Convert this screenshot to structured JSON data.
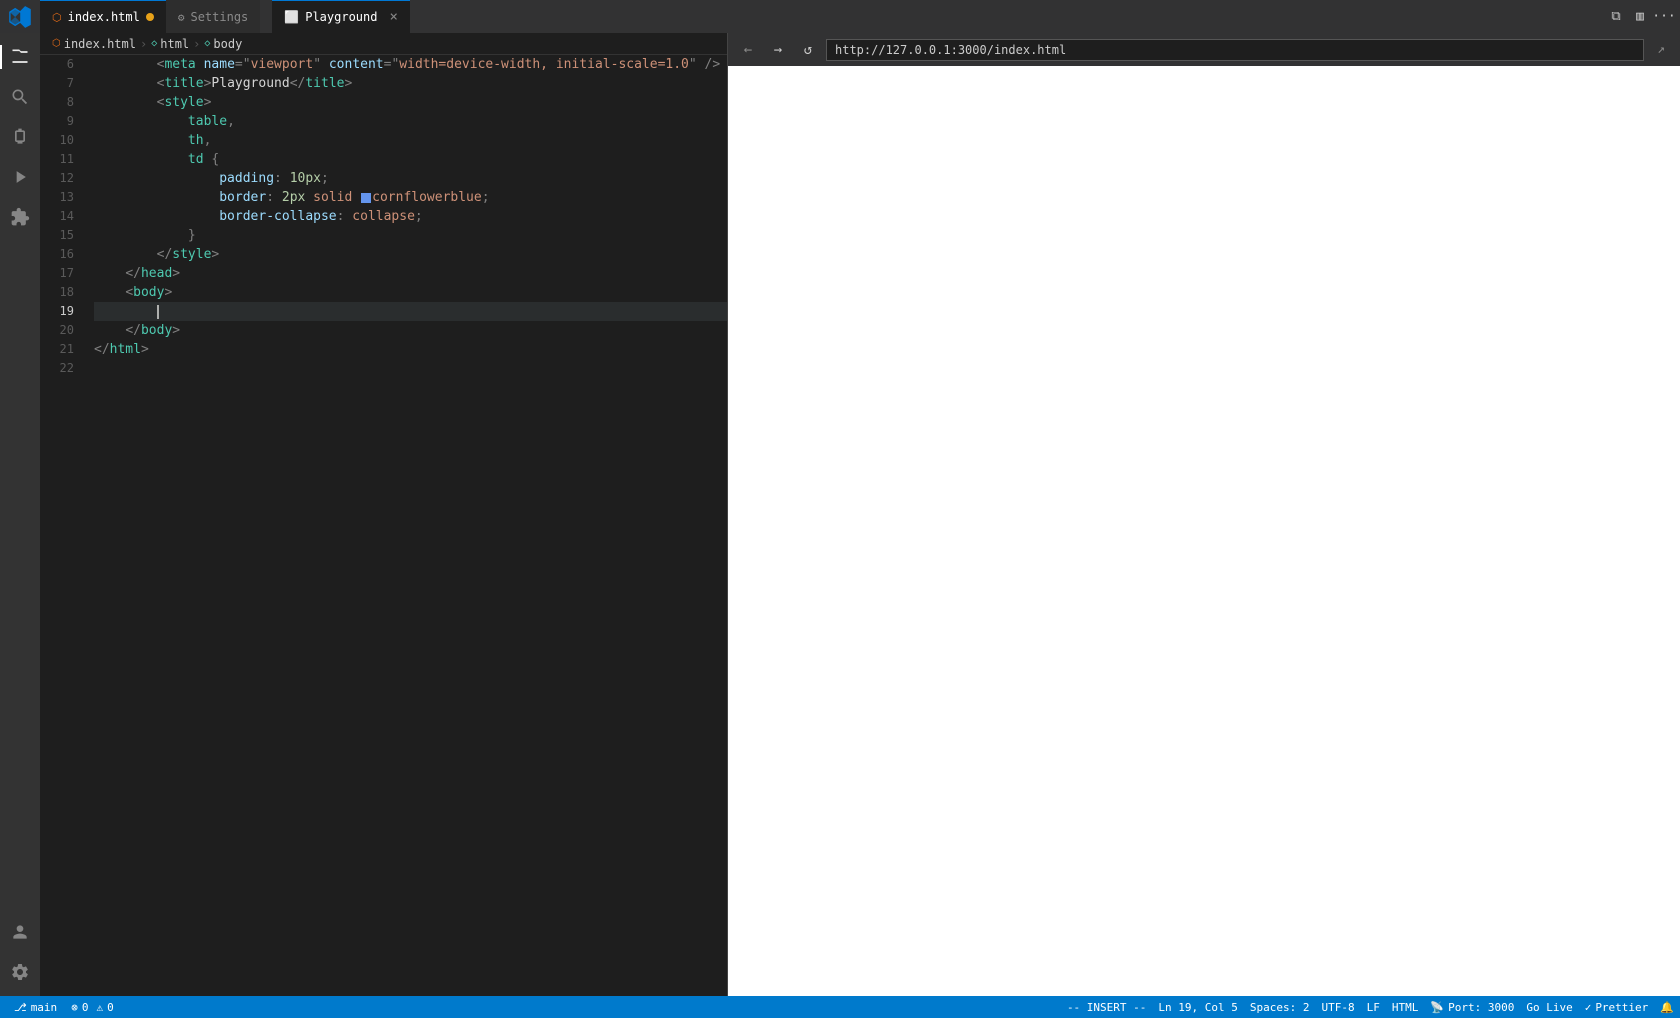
{
  "titleBar": {
    "tabs": [
      {
        "id": "index-html",
        "label": "index.html",
        "icon": "html-icon",
        "active": true,
        "modified": true
      },
      {
        "id": "settings",
        "label": "Settings",
        "icon": "settings-icon",
        "active": false,
        "modified": false
      }
    ],
    "browserTab": {
      "label": "Playground",
      "icon": "globe-icon",
      "close": "×"
    },
    "icons": [
      "split-icon",
      "layout-icon",
      "more-icon"
    ]
  },
  "breadcrumb": {
    "items": [
      "index.html",
      "html",
      "body"
    ]
  },
  "activityBar": {
    "items": [
      {
        "id": "explorer",
        "icon": "files-icon",
        "active": true
      },
      {
        "id": "search",
        "icon": "search-icon",
        "active": false
      },
      {
        "id": "source-control",
        "icon": "git-icon",
        "active": false
      },
      {
        "id": "run",
        "icon": "run-icon",
        "active": false
      },
      {
        "id": "extensions",
        "icon": "extensions-icon",
        "active": false
      }
    ],
    "bottomItems": [
      {
        "id": "account",
        "icon": "account-icon"
      },
      {
        "id": "manage",
        "icon": "manage-icon"
      }
    ]
  },
  "editor": {
    "lines": [
      {
        "num": 6,
        "active": false,
        "content": "meta_viewport"
      },
      {
        "num": 7,
        "active": false,
        "content": "title_playground"
      },
      {
        "num": 8,
        "active": false,
        "content": "style_open"
      },
      {
        "num": 9,
        "active": false,
        "content": "table_comma"
      },
      {
        "num": 10,
        "active": false,
        "content": "th_comma"
      },
      {
        "num": 11,
        "active": false,
        "content": "td_brace"
      },
      {
        "num": 12,
        "active": false,
        "content": "padding"
      },
      {
        "num": 13,
        "active": false,
        "content": "border"
      },
      {
        "num": 14,
        "active": false,
        "content": "border_collapse"
      },
      {
        "num": 15,
        "active": false,
        "content": "close_brace"
      },
      {
        "num": 16,
        "active": false,
        "content": "style_close"
      },
      {
        "num": 17,
        "active": false,
        "content": "head_close"
      },
      {
        "num": 18,
        "active": false,
        "content": "body_open"
      },
      {
        "num": 19,
        "active": true,
        "content": "cursor_line"
      },
      {
        "num": 20,
        "active": false,
        "content": "body_close"
      },
      {
        "num": 21,
        "active": false,
        "content": "html_close"
      },
      {
        "num": 22,
        "active": false,
        "content": "empty"
      }
    ]
  },
  "browser": {
    "url": "http://127.0.0.1:3000/index.html",
    "title": "Playground"
  },
  "statusBar": {
    "left": [
      {
        "id": "git-branch",
        "label": "⎇  main"
      },
      {
        "id": "errors",
        "icon": "error-icon",
        "label": "0"
      },
      {
        "id": "warnings",
        "icon": "warning-icon",
        "label": "0"
      }
    ],
    "right": [
      {
        "id": "mode",
        "label": "-- INSERT --"
      },
      {
        "id": "position",
        "label": "Ln 19, Col 5"
      },
      {
        "id": "spaces",
        "label": "Spaces: 2"
      },
      {
        "id": "encoding",
        "label": "UTF-8"
      },
      {
        "id": "eol",
        "label": "LF"
      },
      {
        "id": "language",
        "label": "HTML"
      },
      {
        "id": "port",
        "icon": "broadcast-icon",
        "label": "Port: 3000"
      },
      {
        "id": "golive",
        "label": "Go Live"
      },
      {
        "id": "prettier",
        "icon": "check-icon",
        "label": "Prettier"
      }
    ]
  },
  "icons": {
    "files": "⬜",
    "search": "🔍",
    "git": "⑂",
    "run": "▷",
    "extensions": "⊞",
    "account": "○",
    "manage": "⚙",
    "back": "←",
    "forward": "→",
    "refresh": "↺",
    "more": "···",
    "split": "⧉",
    "layout": "▥",
    "check": "✓",
    "broadcast": "📡"
  }
}
